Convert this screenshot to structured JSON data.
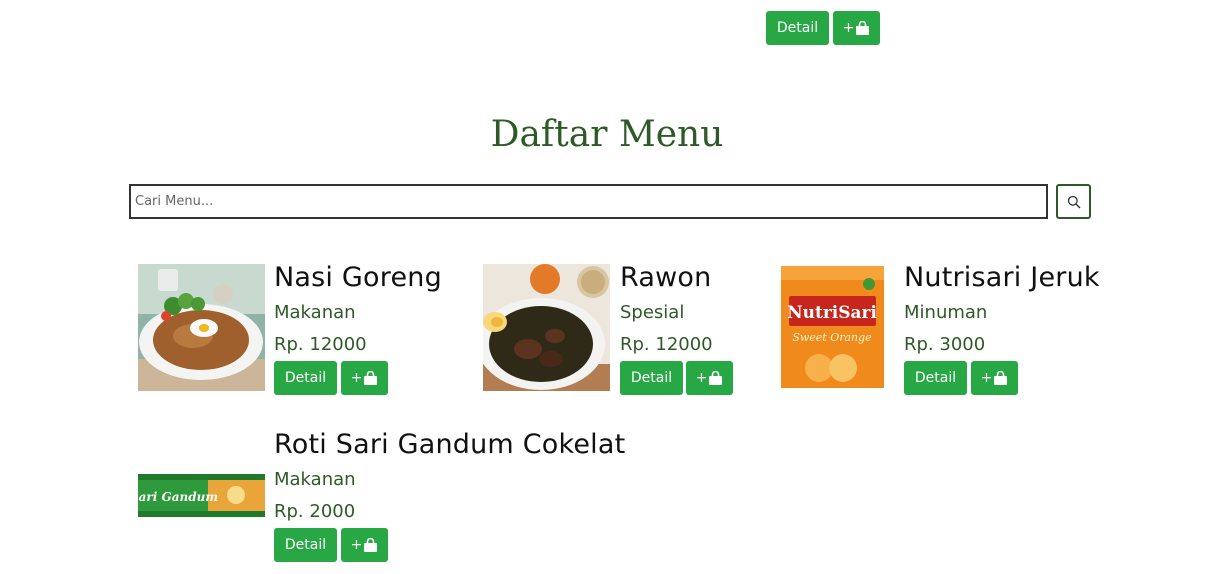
{
  "top_actions": {
    "detail_label": "Detail",
    "cart_label": "+"
  },
  "title": "Daftar Menu",
  "search": {
    "placeholder": "Cari Menu...",
    "value": ""
  },
  "menu": [
    {
      "name": "Nasi Goreng",
      "category": "Makanan",
      "price": "Rp. 12000",
      "detail_label": "Detail",
      "cart_label": "+"
    },
    {
      "name": "Rawon",
      "category": "Spesial",
      "price": "Rp. 12000",
      "detail_label": "Detail",
      "cart_label": "+"
    },
    {
      "name": "Nutrisari Jeruk",
      "category": "Minuman",
      "price": "Rp. 3000",
      "detail_label": "Detail",
      "cart_label": "+"
    },
    {
      "name": "Roti Sari Gandum Cokelat",
      "category": "Makanan",
      "price": "Rp. 2000",
      "detail_label": "Detail",
      "cart_label": "+"
    }
  ],
  "images": {
    "nutrisari_brand": "NutriSari",
    "nutrisari_flavor": "Sweet Orange",
    "sarigandum_brand": "Sari Gandum"
  },
  "colors": {
    "button_green": "#28a745",
    "title_green": "#2e5a27",
    "text_dark": "#111111"
  }
}
